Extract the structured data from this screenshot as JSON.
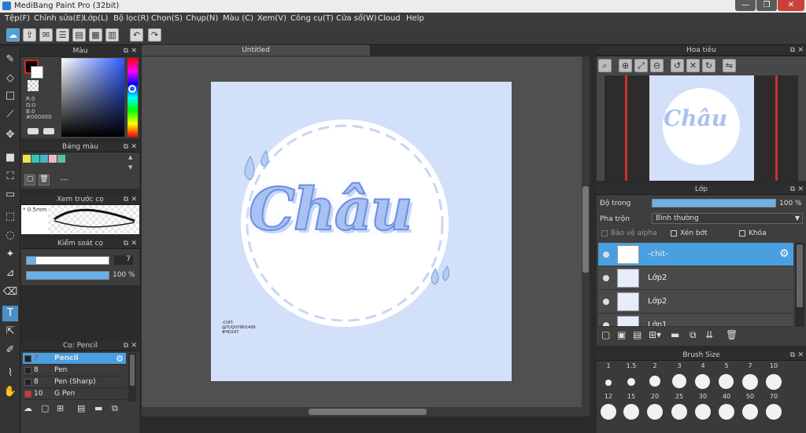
{
  "window": {
    "title": "MediBang Paint Pro (32bit)"
  },
  "menu": [
    "Tệp(F)",
    "Chỉnh sửa(E)",
    "Lớp(L)",
    "Bộ lọc(R)",
    "Chọn(S)",
    "Chụp(N)",
    "Màu (C)",
    "Xem(V)",
    "Công cụ(T)",
    "Cửa sổ(W)",
    "Cloud",
    "Help"
  ],
  "document": {
    "tab": "Untitled"
  },
  "color_panel": {
    "title": "Màu",
    "r": "R:0",
    "g": "G:0",
    "b": "B:0",
    "hex": "#000000"
  },
  "palette_panel": {
    "title": "Bảng màu",
    "value": "---",
    "swatches": [
      "#f4e04d",
      "#2fc6b8",
      "#4bb3c5",
      "#f1b8c4",
      "#5bc0a0"
    ]
  },
  "brush_preview": {
    "title": "Xem trước cọ",
    "size": "0.5mm"
  },
  "brush_control": {
    "title": "Kiểm soát cọ",
    "size": "7",
    "opacity": "100 %"
  },
  "brush_list": {
    "title": "Cọ: Pencil",
    "items": [
      {
        "size": "7",
        "name": "Pencil",
        "color": "#222222"
      },
      {
        "size": "8",
        "name": "Pen",
        "color": "#222222"
      },
      {
        "size": "8",
        "name": "Pen (Sharp)",
        "color": "#222222"
      },
      {
        "size": "10",
        "name": "G Pen",
        "color": "#e03030"
      }
    ]
  },
  "navigator": {
    "title": "Hoa tiêu"
  },
  "artwork": {
    "main_text": "Châu",
    "credits": [
      "-CHIT-",
      "@TUQUYNH1409",
      "#HD247"
    ]
  },
  "layer_panel": {
    "title": "Lớp",
    "opacity_label": "Độ trong",
    "opacity_value": "100 %",
    "blend_label": "Pha trộn",
    "blend_value": "Bình thường",
    "protect_alpha": "Bảo vệ alpha",
    "clipping": "Xén bớt",
    "lock": "Khóa",
    "layers": [
      "-chit-",
      "Lớp2",
      "Lớp2",
      "Lớp1"
    ]
  },
  "brush_size_panel": {
    "title": "Brush Size",
    "row1": [
      "1",
      "1.5",
      "2",
      "3",
      "4",
      "5",
      "7",
      "10"
    ],
    "row2": [
      "12",
      "15",
      "20",
      "25",
      "30",
      "40",
      "50",
      "70"
    ]
  },
  "colors": {
    "accent": "#4a9fe0",
    "canvas_bg": "#d3e0fa",
    "panel": "#3e3e3e"
  }
}
